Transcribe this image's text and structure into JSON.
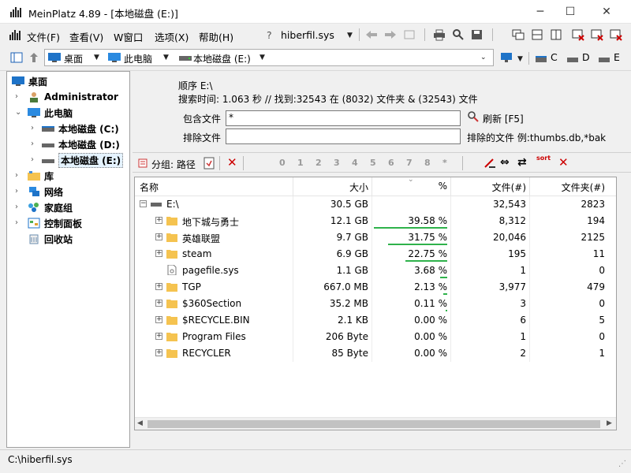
{
  "window": {
    "title": "MeinPlatz 4.89 - [本地磁盘 (E:)]",
    "minimize": "─",
    "maximize": "☐",
    "close": "✕"
  },
  "menu": {
    "items": [
      "文件(F)",
      "查看(V)",
      "W窗口",
      "选项(X)",
      "帮助(H)"
    ],
    "help_file": "hiberfil.sys"
  },
  "address": {
    "desktop": "桌面",
    "this_pc": "此电脑",
    "drive": "本地磁盘 (E:)",
    "drive_c": "C",
    "drive_d": "D",
    "drive_e": "E"
  },
  "tree": {
    "items": [
      {
        "label": "桌面"
      },
      {
        "label": "Administrator"
      },
      {
        "label": "此电脑"
      },
      {
        "label": "本地磁盘 (C:)"
      },
      {
        "label": "本地磁盘 (D:)"
      },
      {
        "label": "本地磁盘 (E:)"
      },
      {
        "label": "库"
      },
      {
        "label": "网络"
      },
      {
        "label": "家庭组"
      },
      {
        "label": "控制面板"
      },
      {
        "label": "回收站"
      }
    ]
  },
  "info": {
    "order": "顺序   E:\\",
    "search_time": "搜索时间: 1.063 秒 //  找到:32543 在 (8032) 文件夹 & (32543) 文件",
    "include_label": "包含文件",
    "include_value": "*",
    "refresh": "刷新 [F5]",
    "exclude_label": "排除文件",
    "exclude_value": "",
    "exclude_hint": "排除的文件 例:thumbs.db,*bak"
  },
  "toolbar2": {
    "group_label": "分组: 路径",
    "nums": [
      "0",
      "1",
      "2",
      "3",
      "4",
      "5",
      "6",
      "7",
      "8",
      "*"
    ],
    "sort": "sort"
  },
  "table": {
    "headers": {
      "name": "名称",
      "size": "大小",
      "pct": "%",
      "files": "文件(#)",
      "folders": "文件夹(#)"
    },
    "root": {
      "name": "E:\\",
      "size": "30.5 GB",
      "pct": "",
      "files": "32,543",
      "folders": "2823"
    },
    "rows": [
      {
        "name": "地下城与勇士",
        "size": "12.1 GB",
        "pct": "39.58 %",
        "files": "8,312",
        "folders": "194",
        "pct_value": 39.58,
        "type": "folder"
      },
      {
        "name": "英雄联盟",
        "size": "9.7 GB",
        "pct": "31.75 %",
        "files": "20,046",
        "folders": "2125",
        "pct_value": 31.75,
        "type": "folder"
      },
      {
        "name": "steam",
        "size": "6.9 GB",
        "pct": "22.75 %",
        "files": "195",
        "folders": "11",
        "pct_value": 22.75,
        "type": "folder"
      },
      {
        "name": "pagefile.sys",
        "size": "1.1 GB",
        "pct": "3.68 %",
        "files": "1",
        "folders": "0",
        "pct_value": 3.68,
        "type": "file"
      },
      {
        "name": "TGP",
        "size": "667.0 MB",
        "pct": "2.13 %",
        "files": "3,977",
        "folders": "479",
        "pct_value": 2.13,
        "type": "folder"
      },
      {
        "name": "$360Section",
        "size": "35.2 MB",
        "pct": "0.11 %",
        "files": "3",
        "folders": "0",
        "pct_value": 0.11,
        "type": "folder"
      },
      {
        "name": "$RECYCLE.BIN",
        "size": "2.1 KB",
        "pct": "0.00 %",
        "files": "6",
        "folders": "5",
        "pct_value": 0,
        "type": "folder"
      },
      {
        "name": "Program Files",
        "size": "206 Byte",
        "pct": "0.00 %",
        "files": "1",
        "folders": "0",
        "pct_value": 0,
        "type": "folder"
      },
      {
        "name": "RECYCLER",
        "size": "85 Byte",
        "pct": "0.00 %",
        "files": "2",
        "folders": "1",
        "pct_value": 0,
        "type": "folder"
      }
    ]
  },
  "status": {
    "text": "C:\\hiberfil.sys"
  },
  "colors": {
    "pct_bar": "#2fb24b",
    "folder": "#f5c350",
    "selection": "#e5f3ff"
  }
}
